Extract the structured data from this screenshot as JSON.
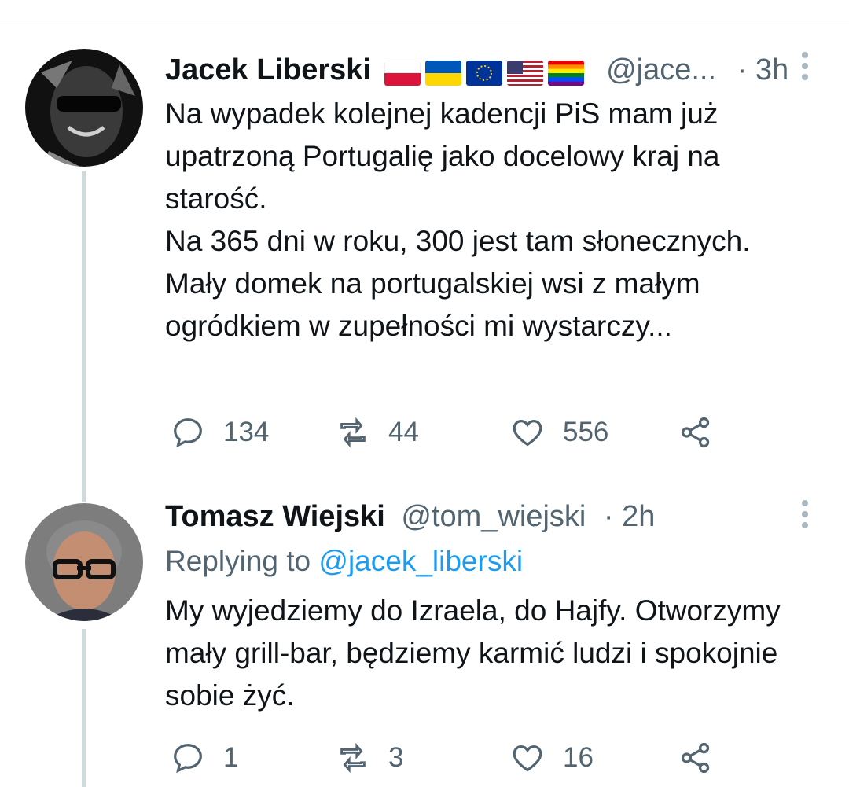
{
  "tweet1": {
    "name": "Jacek Liberski",
    "handle": "@jace...",
    "separator": "·",
    "time": "3h",
    "flags": [
      "poland-flag",
      "ukraine-flag",
      "eu-flag",
      "usa-flag",
      "rainbow-flag"
    ],
    "text": "Na wypadek kolejnej kadencji PiS mam już upatrzoną Portugalię jako docelowy kraj na starość.\nNa 365 dni w roku, 300 jest tam słonecznych. Mały domek na portugalskiej wsi z małym ogródkiem w zupełności mi wystarczy...",
    "replies": "134",
    "retweets": "44",
    "likes": "556"
  },
  "tweet2": {
    "name": "Tomasz Wiejski",
    "handle": "@tom_wiejski",
    "separator": "·",
    "time": "2h",
    "replying_prefix": "Replying to",
    "replying_handle": "@jacek_liberski",
    "text": "My wyjedziemy do Izraela, do Hajfy. Otworzymy mały grill-bar, będziemy karmić ludzi i spokojnie sobie żyć.",
    "replies": "1",
    "retweets": "3",
    "likes": "16"
  },
  "colors": {
    "muted": "#536471",
    "accent": "#1d9bf0",
    "thread": "#cfd9de"
  },
  "icons": [
    "reply-icon",
    "retweet-icon",
    "like-icon",
    "share-icon",
    "more-options-icon"
  ]
}
